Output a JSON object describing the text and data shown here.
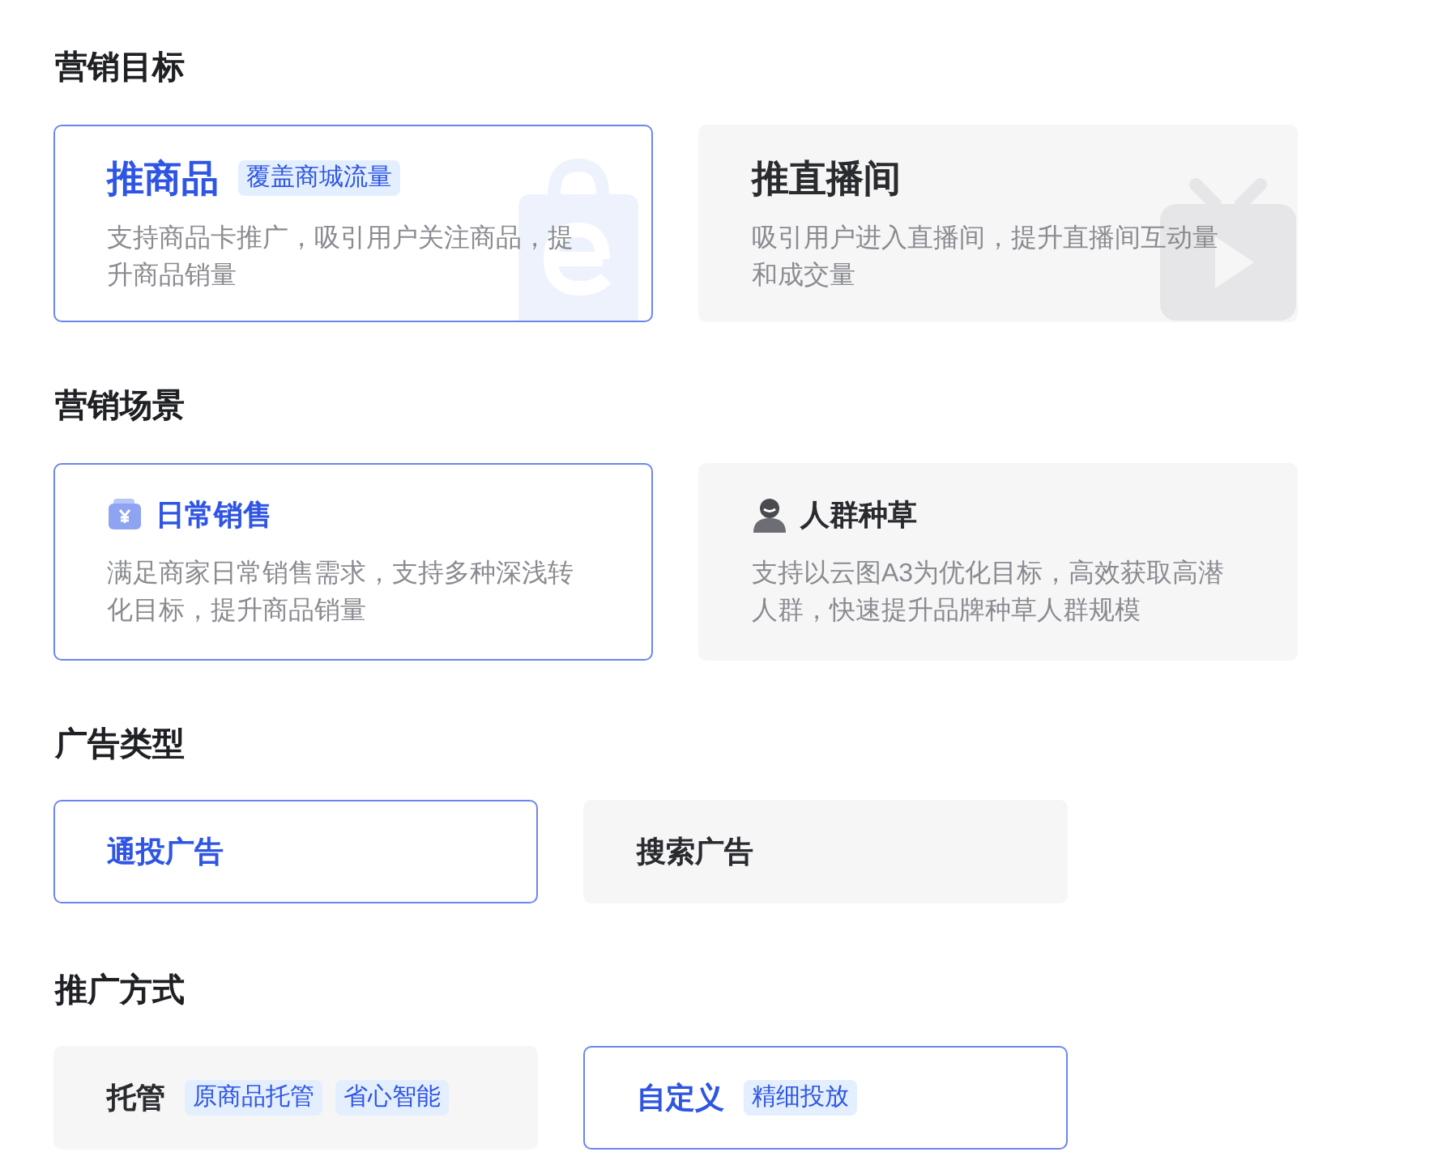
{
  "sections": [
    {
      "title": "营销目标",
      "kind": "large",
      "options": [
        {
          "title": "推商品",
          "tags": [
            "覆盖商城流量"
          ],
          "description": "支持商品卡推广，吸引用户关注商品，提升商品销量",
          "selected": true
        },
        {
          "title": "推直播间",
          "description": "吸引用户进入直播间，提升直播间互动量和成交量",
          "selected": false
        }
      ]
    },
    {
      "title": "营销场景",
      "kind": "medium",
      "options": [
        {
          "title": "日常销售",
          "description": "满足商家日常销售需求，支持多种深浅转化目标，提升商品销量",
          "selected": true
        },
        {
          "title": "人群种草",
          "description": "支持以云图A3为优化目标，高效获取高潜人群，快速提升品牌种草人群规模",
          "selected": false
        }
      ]
    },
    {
      "title": "广告类型",
      "kind": "small",
      "options": [
        {
          "title": "通投广告",
          "selected": true
        },
        {
          "title": "搜索广告",
          "selected": false
        }
      ]
    },
    {
      "title": "推广方式",
      "kind": "small",
      "options": [
        {
          "title": "托管",
          "tags": [
            "原商品托管",
            "省心智能"
          ],
          "selected": false
        },
        {
          "title": "自定义",
          "tags": [
            "精细投放"
          ],
          "selected": true
        }
      ]
    }
  ]
}
